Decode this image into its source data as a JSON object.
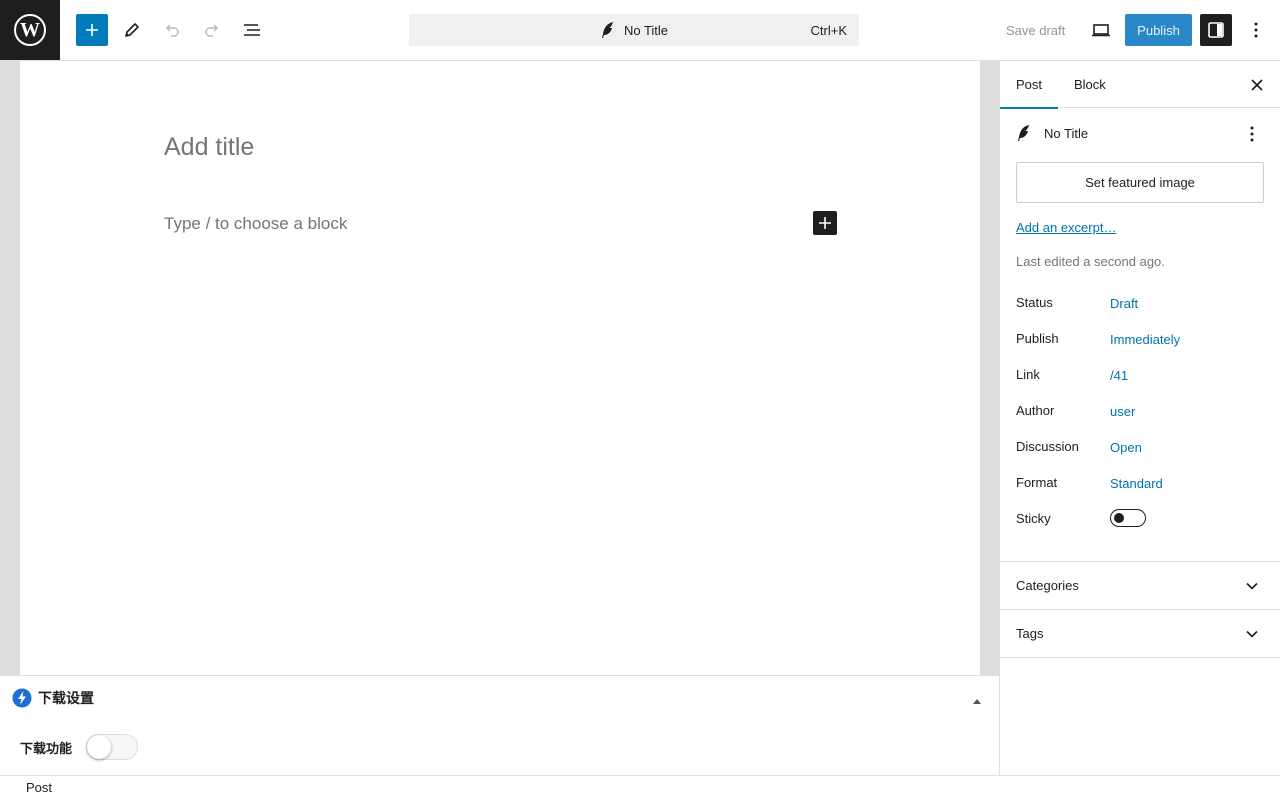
{
  "header": {
    "logo_letter": "W",
    "document_title": "No Title",
    "shortcut": "Ctrl+K",
    "save_draft_label": "Save draft",
    "publish_label": "Publish"
  },
  "editor": {
    "title_placeholder": "Add title",
    "block_placeholder": "Type / to choose a block"
  },
  "metabox": {
    "title": "下载设置",
    "download_label": "下载功能",
    "download_enabled": false
  },
  "footer": {
    "breadcrumb": "Post"
  },
  "sidebar": {
    "tabs": [
      {
        "label": "Post",
        "active": true
      },
      {
        "label": "Block",
        "active": false
      }
    ],
    "post_title": "No Title",
    "featured_image_label": "Set featured image",
    "excerpt_link": "Add an excerpt…",
    "last_edited": "Last edited a second ago.",
    "properties": [
      {
        "label": "Status",
        "value": "Draft"
      },
      {
        "label": "Publish",
        "value": "Immediately"
      },
      {
        "label": "Link",
        "value": "/41"
      },
      {
        "label": "Author",
        "value": "user"
      },
      {
        "label": "Discussion",
        "value": "Open"
      },
      {
        "label": "Format",
        "value": "Standard"
      }
    ],
    "sticky_label": "Sticky",
    "sticky_enabled": false,
    "panels": [
      {
        "label": "Categories"
      },
      {
        "label": "Tags"
      }
    ]
  },
  "colors": {
    "accent": "#007cba",
    "link": "#0073aa",
    "dark": "#1e1e1e",
    "publish_button": "#2b88c8"
  },
  "icons": {
    "add": "plus-icon",
    "tools": "pencil-icon",
    "undo": "undo-icon",
    "redo": "redo-icon",
    "list_view": "list-view-icon",
    "post_type": "feather-icon",
    "preview": "laptop-icon",
    "settings": "sidebar-icon",
    "options": "kebab-icon",
    "close": "close-icon",
    "chevron": "chevron-down-icon",
    "metabox_logo": "lightning-icon",
    "collapse": "triangle-up-icon"
  }
}
